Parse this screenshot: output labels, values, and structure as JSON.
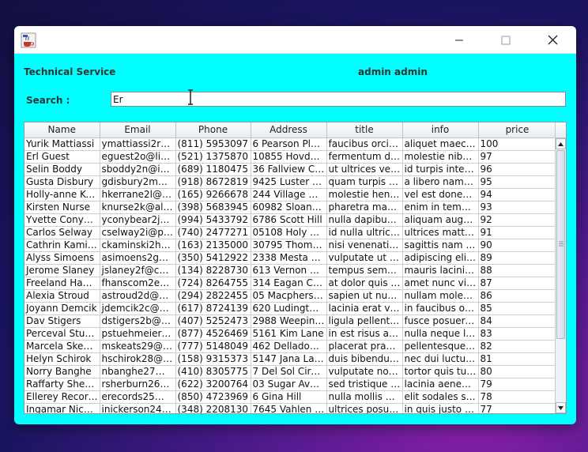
{
  "header": {
    "title": "Technical Service",
    "user": "admin admin"
  },
  "search": {
    "label": "Search :",
    "value": "Er"
  },
  "table": {
    "columns": [
      "Name",
      "Email",
      "Phone",
      "Address",
      "title",
      "info",
      "price"
    ],
    "rows": [
      [
        "Yurik Mattiassi",
        "ymattiassi2r@i...",
        "(811) 5953097",
        "6 Pearson Plaza",
        "faucibus orci lu...",
        "aliquet maece...",
        "100"
      ],
      [
        "Erl Guest",
        "eguest2o@live...",
        "(521) 1375870",
        "10855 Hovde ...",
        "fermentum do...",
        "molestie nibh i...",
        "97"
      ],
      [
        "Selin Boddy",
        "sboddy2n@int...",
        "(689) 1180475",
        "36 Fallview Cro...",
        "ut ultrices vel a...",
        "id turpis intege...",
        "96"
      ],
      [
        "Gusta Disbury",
        "gdisbury2m@n...",
        "(918) 8672819",
        "9425 Luster Po...",
        "quam turpis ad...",
        "a libero nam d...",
        "95"
      ],
      [
        "Holly-anne Ker...",
        "hkerrane2l@re...",
        "(165) 9266678",
        "244 Village Ce...",
        "molestie hendr...",
        "vel est donec o...",
        "94"
      ],
      [
        "Kirsten Nurse",
        "knurse2k@alib...",
        "(398) 5683945",
        "60982 Sloan R...",
        "pharetra magn...",
        "enim in tempor...",
        "93"
      ],
      [
        "Yvette Conybear",
        "yconybear2j@i...",
        "(994) 5433792",
        "6786 Scott Hill",
        "nulla dapibus ...",
        "aliquam augue...",
        "92"
      ],
      [
        "Carlos Selway",
        "cselway2i@ph...",
        "(740) 2477271",
        "05108 Holy Cr...",
        "id nulla ultrices...",
        "ultrices mattis ...",
        "91"
      ],
      [
        "Cathrin Kamin...",
        "ckaminski2h@...",
        "(163) 2135000",
        "30795 Thomps...",
        "nisi venenatis t...",
        "sagittis nam co...",
        "90"
      ],
      [
        "Alyss Simoens",
        "asimoens2g@...",
        "(350) 5412922",
        "2338 Mesta Alley",
        "vulputate ut ultr...",
        "adipiscing elit ...",
        "89"
      ],
      [
        "Jerome Slaney",
        "jslaney2f@chin...",
        "(134) 8228730",
        "613 Vernon Pla...",
        "tempus semp...",
        "mauris lacinia ...",
        "88"
      ],
      [
        "Freeland Hans...",
        "fhanscom2e@...",
        "(724) 8264755",
        "314 Eagan Court",
        "at dolor quis o...",
        "amet nunc vive...",
        "87"
      ],
      [
        "Alexia Stroud",
        "astroud2d@a...",
        "(294) 2822455",
        "05 Macpherso...",
        "sapien ut nunc...",
        "nullam molesti...",
        "86"
      ],
      [
        "Joyann Demcik",
        "jdemcik2c@art...",
        "(617) 8724139",
        "620 Ludington ...",
        "lacinia erat ves...",
        "in faucibus orci...",
        "85"
      ],
      [
        "Dav Stigers",
        "dstigers2b@pr...",
        "(407) 5252473",
        "2988 Weeping ...",
        "ligula pellente...",
        "fusce posuere ...",
        "84"
      ],
      [
        "Perceval Stueh...",
        "pstuehmeier2a...",
        "(877) 4526469",
        "5161 Kim Lane",
        "in est risus au...",
        "nulla neque lib...",
        "83"
      ],
      [
        "Marcela Skeats",
        "mskeats29@a...",
        "(777) 5148049",
        "462 Delladonn...",
        "placerat praes...",
        "pellentesque e...",
        "82"
      ],
      [
        "Helyn Schirok",
        "hschirok28@1...",
        "(158) 9315373",
        "5147 Jana Lane",
        "duis bibendum...",
        "nec dui luctus r...",
        "81"
      ],
      [
        "Norry Banghe",
        "nbanghe27@...",
        "(410) 8305775",
        "7 Del Sol Circle",
        "vulputate nonu...",
        "tortor quis turpi...",
        "80"
      ],
      [
        "Raffarty Sherb...",
        "rsherburn26@l...",
        "(622) 3200764",
        "03 Sugar Avenue",
        "sed tristique in...",
        "lacinia aenean ...",
        "79"
      ],
      [
        "Ellerey Records",
        "erecords25@u...",
        "(850) 4723969",
        "6 Gina Hill",
        "nulla mollis m...",
        "elit sodales sc...",
        "78"
      ],
      [
        "Ingamar Nicke...",
        "inickerson24@...",
        "(348) 2208130",
        "7645 Vahlen Av...",
        "ultrices posuer...",
        "in quis justo m...",
        "77"
      ]
    ]
  },
  "icons": {
    "app": "java-coffee-cup-icon",
    "minimize": "minimize-icon",
    "maximize": "maximize-icon",
    "close": "close-icon"
  },
  "colors": {
    "window_bg": "#00ffff",
    "table_bg": "#ffffff"
  }
}
